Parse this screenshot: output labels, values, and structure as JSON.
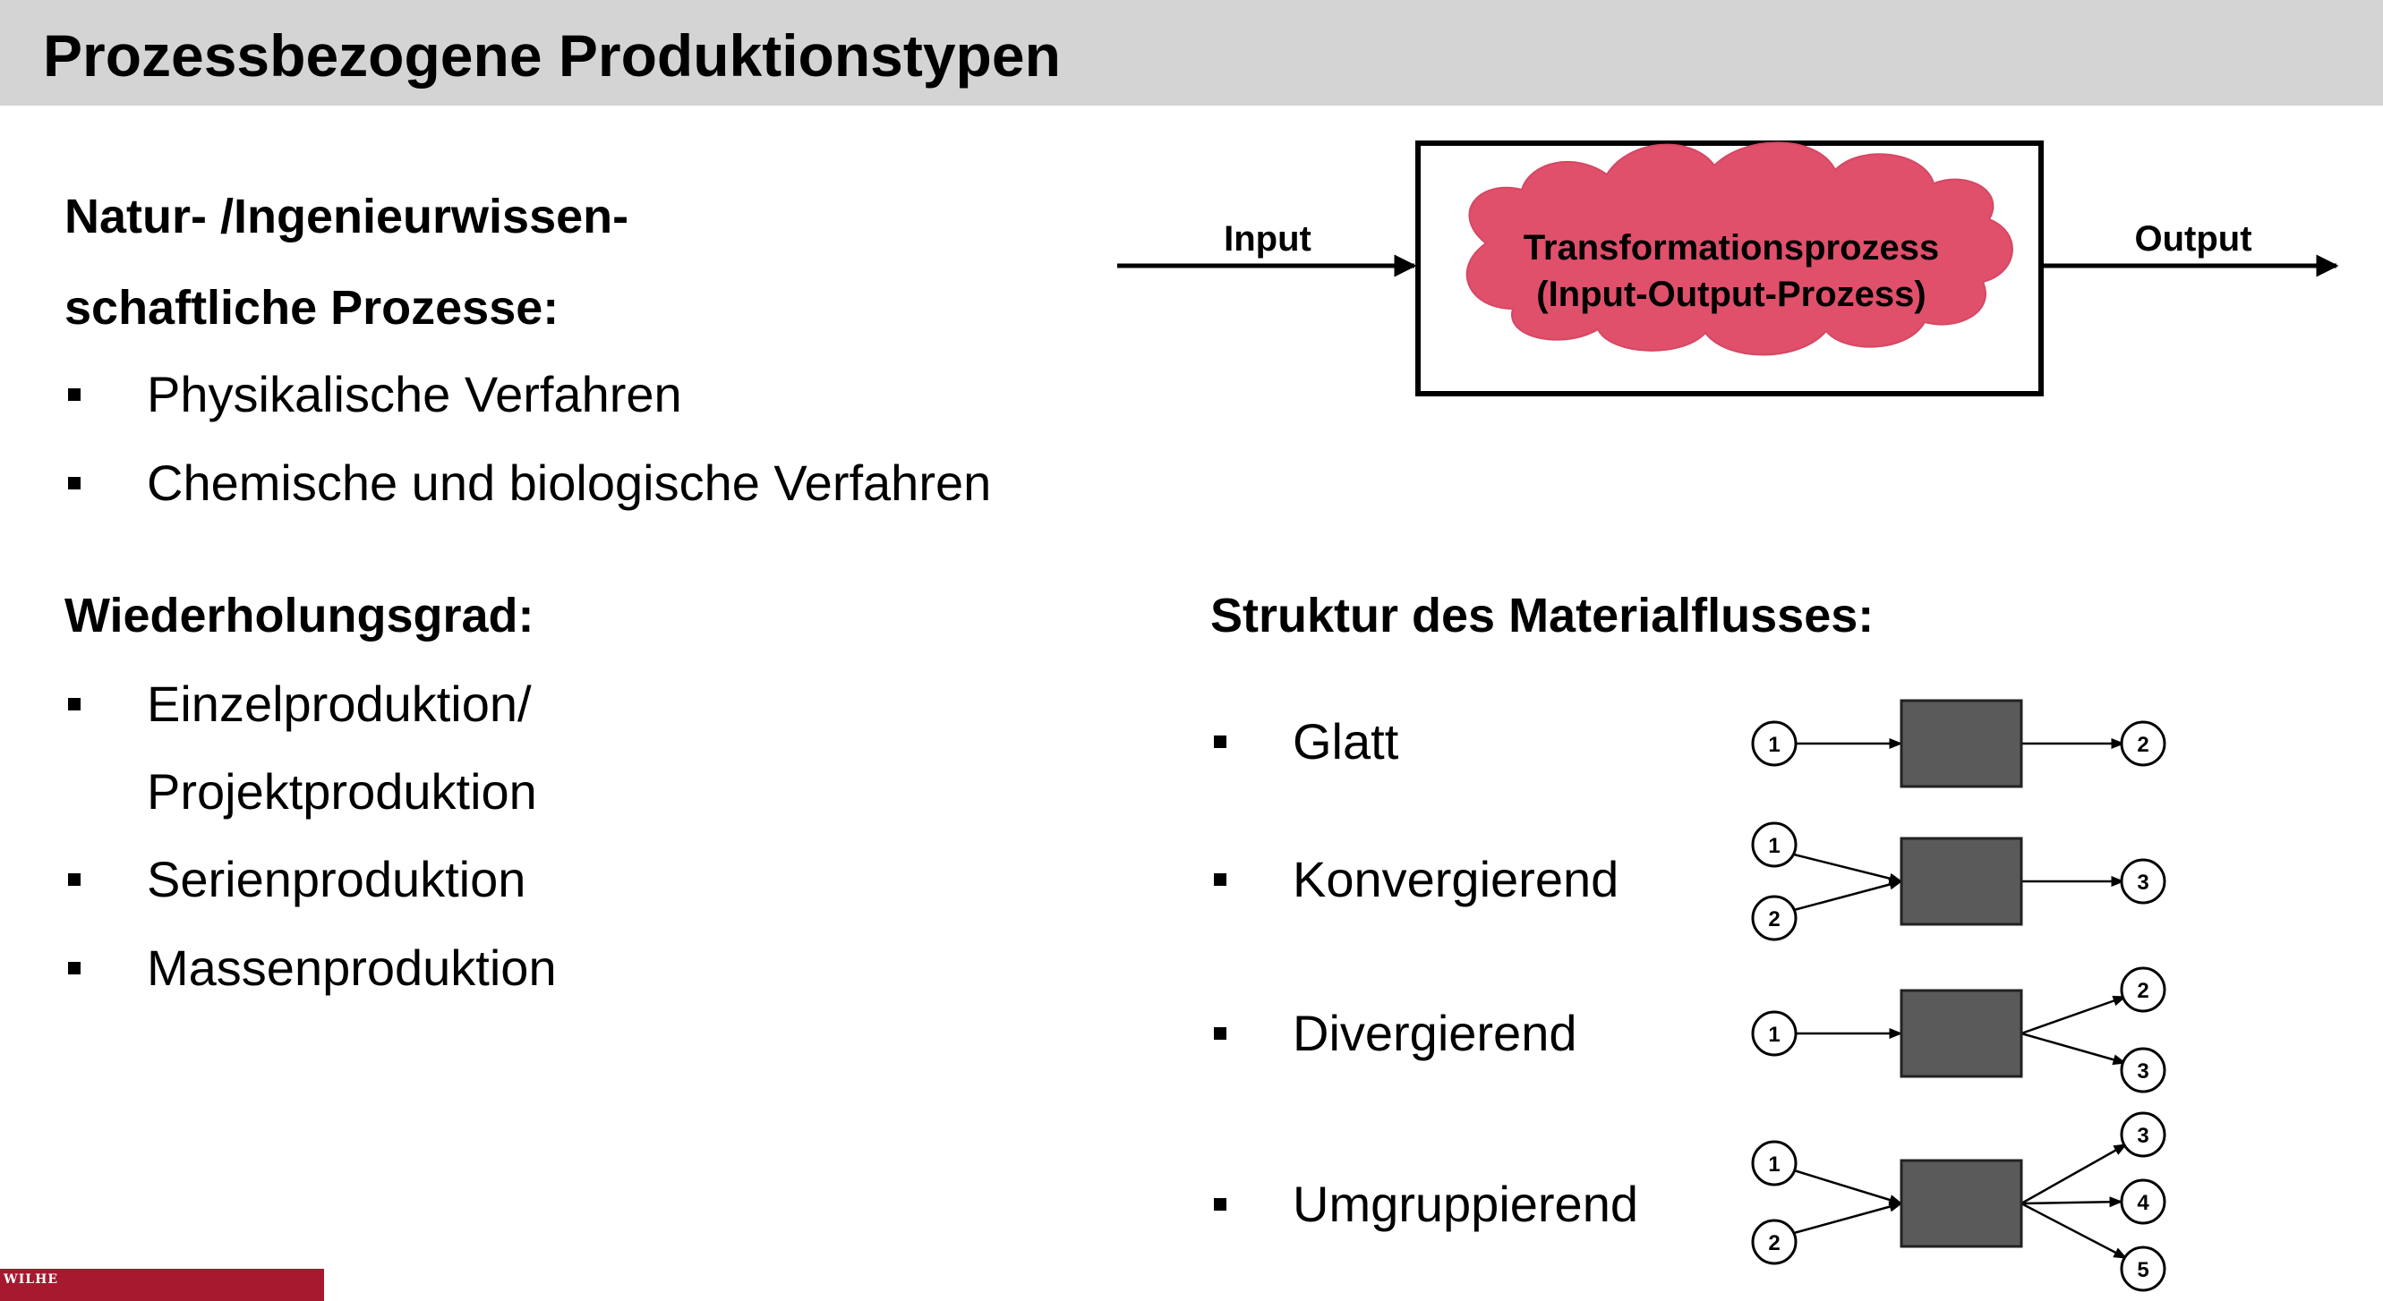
{
  "page": {
    "title": "Prozessbezogene Produktionstypen"
  },
  "left_column": {
    "section1": {
      "heading_line1": "Natur- /Ingenieurwissen-",
      "heading_line2": "schaftliche Prozesse:",
      "items": [
        "Physikalische Verfahren",
        "Chemische und biologische Verfahren"
      ]
    },
    "section2": {
      "heading": "Wiederholungsgrad:",
      "items": [
        {
          "line1": "Einzelproduktion/",
          "line2": "Projektproduktion"
        },
        {
          "line1": "Serienproduktion"
        },
        {
          "line1": "Massenproduktion"
        }
      ]
    }
  },
  "transformation_diagram": {
    "input_label": "Input",
    "output_label": "Output",
    "process_line1": "Transformationsprozess",
    "process_line2": "(Input-Output-Prozess)",
    "cloud_color": "#e0506b"
  },
  "material_flow": {
    "heading": "Struktur des Materialflusses:",
    "box_color": "#5a5a5a",
    "rows": [
      {
        "label": "Glatt",
        "inputs": [
          "1"
        ],
        "outputs": [
          "2"
        ]
      },
      {
        "label": "Konvergierend",
        "inputs": [
          "1",
          "2"
        ],
        "outputs": [
          "3"
        ]
      },
      {
        "label": "Divergierend",
        "inputs": [
          "1"
        ],
        "outputs": [
          "2",
          "3"
        ]
      },
      {
        "label": "Umgruppierend",
        "inputs": [
          "1",
          "2"
        ],
        "outputs": [
          "3",
          "4",
          "5"
        ]
      }
    ]
  },
  "logo": {
    "text": "WILHE",
    "color": "#a6192e"
  }
}
